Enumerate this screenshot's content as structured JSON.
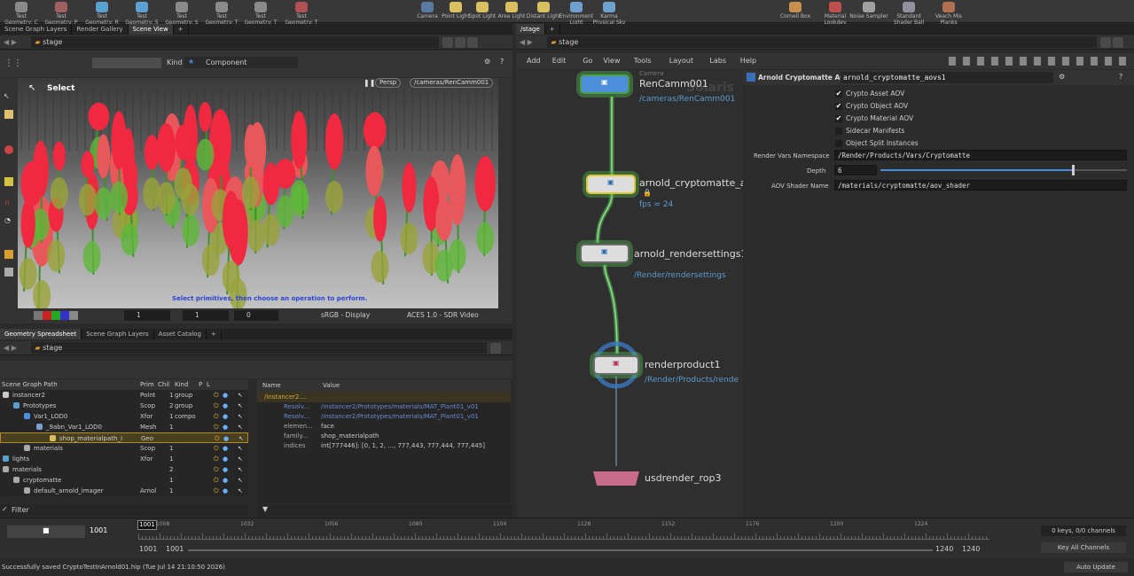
{
  "shelf": {
    "items": [
      "Test Geometry: C",
      "Test Geometry: P",
      "Test Geometry: R",
      "Test Geometry: S",
      "Test Geometry: S",
      "Test Geometry: T",
      "Test Geometry: T",
      "Test Geometry: T",
      "Camera",
      "Point Light",
      "Spot Light",
      "Area Light",
      "Distant Light",
      "Environment Light",
      "Karma Physical Sky",
      "Cornell Box",
      "Material Lookdev",
      "Noise Sampler",
      "Standard Shader Ball",
      "Veach Mis Planks"
    ]
  },
  "left_tabs": [
    "Scene Graph Layers",
    "Render Gallery",
    "Scene View"
  ],
  "left_path": "stage",
  "viewport": {
    "kind_label": "Kind",
    "kind_value": "Component",
    "select_label": "Select",
    "persp": "Persp",
    "camera": "/cameras/RenCamm001",
    "hint": "Select primitives, then choose an operation to perform.",
    "v1": "1",
    "v2": "1",
    "v3": "0",
    "display": "sRGB - Display",
    "view": "ACES 1.0 - SDR Video"
  },
  "bottom_tabs": [
    "Geometry Spreadsheet",
    "Scene Graph Layers",
    "Asset Catalog"
  ],
  "bottom_path": "stage",
  "tree": {
    "headers": [
      "Scene Graph Path",
      "Prim",
      "Chil",
      "Kind",
      "P",
      "L"
    ],
    "rows": [
      {
        "name": "instancer2",
        "prim": "Point",
        "chil": "1",
        "kind": "group"
      },
      {
        "name": "Prototypes",
        "prim": "Scop",
        "chil": "2",
        "kind": "group"
      },
      {
        "name": "Var1_LOD0",
        "prim": "Xfor",
        "chil": "1",
        "kind": "compo"
      },
      {
        "name": "_9abn_Var1_LOD0",
        "prim": "Mesh",
        "chil": "1",
        "kind": ""
      },
      {
        "name": "shop_materialpath_I",
        "prim": "Geo",
        "chil": "",
        "kind": ""
      },
      {
        "name": "materials",
        "prim": "Scop",
        "chil": "1",
        "kind": ""
      },
      {
        "name": "lights",
        "prim": "Xfor",
        "chil": "1",
        "kind": ""
      },
      {
        "name": "materials",
        "prim": "",
        "chil": "2",
        "kind": ""
      },
      {
        "name": "cryptomatte",
        "prim": "",
        "chil": "1",
        "kind": ""
      },
      {
        "name": "default_arnold_imager",
        "prim": "Arnol",
        "chil": "1",
        "kind": ""
      }
    ],
    "filter": "Filter"
  },
  "props": {
    "headers": [
      "Name",
      "Value"
    ],
    "root": "/instancer2....",
    "rows": [
      {
        "name": "Resolv...",
        "value": "/instancer2/Prototypes/materials/MAT_Plant01_v01"
      },
      {
        "name": "Resolv...",
        "value": "/instancer2/Prototypes/materials/MAT_Plant01_v01"
      },
      {
        "name": "elemen...",
        "value": "face"
      },
      {
        "name": "family...",
        "value": "shop_materialpath"
      },
      {
        "name": "indices",
        "value": "int[777446]: [0, 1, 2, ..., 777,443, 777,444, 777,445]"
      }
    ]
  },
  "timeline": {
    "frame": "1001",
    "start_box": "1001",
    "ticks": [
      "1008",
      "1032",
      "1056",
      "1080",
      "1104",
      "1128",
      "1152",
      "1176",
      "1200",
      "1224"
    ],
    "range_start": "1001",
    "range_start2": "1001",
    "range_end": "1240",
    "range_end2": "1240",
    "keys": "0 keys, 0/0 channels",
    "channels": "Key All Channels",
    "auto": "Auto Update"
  },
  "status": "Successfully saved CryptoTestInArnold01.hip (Tue Jul 14 21:10:50 2026)",
  "network": {
    "tab": "/stage",
    "path": "stage",
    "menu": [
      "Add",
      "Edit",
      "Go",
      "View",
      "Tools",
      "Layout",
      "Labs",
      "Help"
    ],
    "watermark": "Solaris",
    "nodes": [
      {
        "label": "RenCamm001",
        "sub": "/cameras/RenCamm001",
        "tag": "Camera"
      },
      {
        "label": "arnold_cryptomatte_ac",
        "sub": "fps = 24"
      },
      {
        "label": "arnold_rendersettings1",
        "sub": "/Render/rendersettings"
      },
      {
        "label": "renderproduct1",
        "sub": "/Render/Products/rende"
      },
      {
        "label": "usdrender_rop3",
        "sub": ""
      }
    ]
  },
  "params": {
    "title": "Arnold Cryptomatte AOVs",
    "name": "arnold_cryptomatte_aovs1",
    "checks": [
      {
        "label": "Crypto Asset AOV",
        "on": true
      },
      {
        "label": "Crypto Object AOV",
        "on": true
      },
      {
        "label": "Crypto Material AOV",
        "on": true
      },
      {
        "label": "Sidecar Manifests",
        "on": false
      },
      {
        "label": "Object Split Instances",
        "on": false
      }
    ],
    "ns_label": "Render Vars Namespace",
    "ns_value": "/Render/Products/Vars/Cryptomatte",
    "depth_label": "Depth",
    "depth_value": "6",
    "depth_fraction": 0.78,
    "shader_label": "AOV Shader Name",
    "shader_value": "/materials/cryptomatte/aov_shader"
  }
}
